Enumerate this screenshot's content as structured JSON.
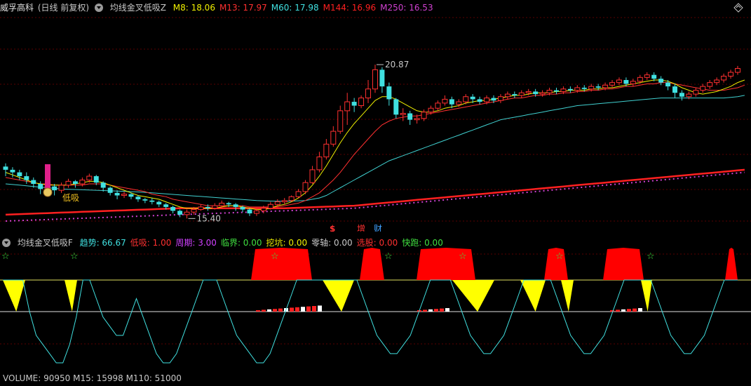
{
  "main_chart": {
    "stock_name": "威孚高科",
    "period": "(日线 前复权)",
    "indicator_name": "均线金叉低吸Z",
    "ma_items": [
      {
        "label": "M8: 18.06",
        "color": "#f0f000"
      },
      {
        "label": "M13: 17.97",
        "color": "#ff3030"
      },
      {
        "label": "M60: 17.98",
        "color": "#40e0e0"
      },
      {
        "label": "M144: 16.96",
        "color": "#ff2020"
      },
      {
        "label": "M250: 16.53",
        "color": "#d040d0"
      }
    ],
    "high_label": "20.87",
    "low_label": "15.40",
    "signal_text": "低吸",
    "marker_s": "$",
    "marker_zeng": "增",
    "marker_cai": "财",
    "candles": [
      [
        9.25,
        9.0,
        8.5,
        9.5
      ],
      [
        9.0,
        8.8,
        8.4,
        9.2
      ],
      [
        8.8,
        8.5,
        8.2,
        9.0
      ],
      [
        8.5,
        8.2,
        7.9,
        8.8
      ],
      [
        8.2,
        7.9,
        7.6,
        8.4
      ],
      [
        7.9,
        7.5,
        7.1,
        8.1
      ],
      [
        7.5,
        7.7,
        7.3,
        7.9
      ],
      [
        7.7,
        7.4,
        7.0,
        7.9
      ],
      [
        7.4,
        7.8,
        7.2,
        8.0
      ],
      [
        7.8,
        8.1,
        7.6,
        8.3
      ],
      [
        8.1,
        7.9,
        7.6,
        8.2
      ],
      [
        7.9,
        8.2,
        7.7,
        8.4
      ],
      [
        8.2,
        8.5,
        8.0,
        8.7
      ],
      [
        8.5,
        8.0,
        7.8,
        8.6
      ],
      [
        8.0,
        7.6,
        7.3,
        8.1
      ],
      [
        7.6,
        7.2,
        7.0,
        7.7
      ],
      [
        7.2,
        7.0,
        6.7,
        7.4
      ],
      [
        7.0,
        7.1,
        6.8,
        7.3
      ],
      [
        7.1,
        6.9,
        6.7,
        7.2
      ],
      [
        6.9,
        6.7,
        6.5,
        7.0
      ],
      [
        6.7,
        6.6,
        6.4,
        6.8
      ],
      [
        6.6,
        6.5,
        6.3,
        6.8
      ],
      [
        6.5,
        6.3,
        6.1,
        6.6
      ],
      [
        6.3,
        6.1,
        5.9,
        6.4
      ],
      [
        6.1,
        5.8,
        5.6,
        6.2
      ],
      [
        5.8,
        5.5,
        5.3,
        5.9
      ],
      [
        5.5,
        5.7,
        5.2,
        5.9
      ],
      [
        5.7,
        5.9,
        5.5,
        6.1
      ],
      [
        5.9,
        6.1,
        5.8,
        6.3
      ],
      [
        6.1,
        6.0,
        5.8,
        6.3
      ],
      [
        6.0,
        6.2,
        5.9,
        6.4
      ],
      [
        6.2,
        6.4,
        6.0,
        6.6
      ],
      [
        6.4,
        6.3,
        6.1,
        6.5
      ],
      [
        6.3,
        6.1,
        5.8,
        6.4
      ],
      [
        6.1,
        5.9,
        5.7,
        6.2
      ],
      [
        5.9,
        5.6,
        5.4,
        6.0
      ],
      [
        5.6,
        5.8,
        5.4,
        6.0
      ],
      [
        5.8,
        6.0,
        5.6,
        6.2
      ],
      [
        6.0,
        6.3,
        5.9,
        6.5
      ],
      [
        6.3,
        6.5,
        6.1,
        6.7
      ],
      [
        6.5,
        6.6,
        6.3,
        6.8
      ],
      [
        6.6,
        6.9,
        6.5,
        7.0
      ],
      [
        6.9,
        7.3,
        6.8,
        7.5
      ],
      [
        7.3,
        8.0,
        7.1,
        8.2
      ],
      [
        8.0,
        9.0,
        7.9,
        9.3
      ],
      [
        9.0,
        10.0,
        8.8,
        10.4
      ],
      [
        10.0,
        11.0,
        9.8,
        11.4
      ],
      [
        11.0,
        12.0,
        10.8,
        12.4
      ],
      [
        12.0,
        13.6,
        11.8,
        14.0
      ],
      [
        13.6,
        14.3,
        12.5,
        15.0
      ],
      [
        14.3,
        14.0,
        13.5,
        14.6
      ],
      [
        14.0,
        14.6,
        13.8,
        14.8
      ],
      [
        14.6,
        15.3,
        14.2,
        16.0
      ],
      [
        15.3,
        16.8,
        15.0,
        17.2
      ],
      [
        16.8,
        15.5,
        15.0,
        17.0
      ],
      [
        15.5,
        14.5,
        14.0,
        15.8
      ],
      [
        14.5,
        13.3,
        13.0,
        14.6
      ],
      [
        13.3,
        13.4,
        12.8,
        13.8
      ],
      [
        13.4,
        12.9,
        12.5,
        13.6
      ],
      [
        12.9,
        13.0,
        12.6,
        13.3
      ],
      [
        13.0,
        13.5,
        12.8,
        13.7
      ],
      [
        13.5,
        13.8,
        13.3,
        14.0
      ],
      [
        13.8,
        14.2,
        13.6,
        14.4
      ],
      [
        14.2,
        14.5,
        14.0,
        14.8
      ],
      [
        14.5,
        14.1,
        13.8,
        14.7
      ],
      [
        14.1,
        14.3,
        13.9,
        14.5
      ],
      [
        14.3,
        14.7,
        14.1,
        14.9
      ],
      [
        14.7,
        14.5,
        14.2,
        14.9
      ],
      [
        14.5,
        14.3,
        14.1,
        14.7
      ],
      [
        14.3,
        14.6,
        14.1,
        14.8
      ],
      [
        14.6,
        14.4,
        14.2,
        14.8
      ],
      [
        14.4,
        14.7,
        14.2,
        14.9
      ],
      [
        14.7,
        14.9,
        14.5,
        15.1
      ],
      [
        14.9,
        14.8,
        14.6,
        15.1
      ],
      [
        14.8,
        15.0,
        14.6,
        15.2
      ],
      [
        15.0,
        15.1,
        14.8,
        15.3
      ],
      [
        15.1,
        14.9,
        14.7,
        15.3
      ],
      [
        14.9,
        15.0,
        14.7,
        15.2
      ],
      [
        15.0,
        15.2,
        14.8,
        15.4
      ],
      [
        15.2,
        15.1,
        14.9,
        15.4
      ],
      [
        15.1,
        15.3,
        14.9,
        15.5
      ],
      [
        15.3,
        15.2,
        15.0,
        15.5
      ],
      [
        15.2,
        15.4,
        15.0,
        15.6
      ],
      [
        15.4,
        15.3,
        15.1,
        15.6
      ],
      [
        15.3,
        15.5,
        15.1,
        15.7
      ],
      [
        15.5,
        15.4,
        15.2,
        15.7
      ],
      [
        15.4,
        15.6,
        15.2,
        15.8
      ],
      [
        15.6,
        15.8,
        15.4,
        16.0
      ],
      [
        15.8,
        16.0,
        15.6,
        16.2
      ],
      [
        16.0,
        15.7,
        15.5,
        16.2
      ],
      [
        15.7,
        15.9,
        15.5,
        16.1
      ],
      [
        15.9,
        16.2,
        15.7,
        16.4
      ],
      [
        16.2,
        16.4,
        16.0,
        16.6
      ],
      [
        16.4,
        16.1,
        15.9,
        16.6
      ],
      [
        16.1,
        15.8,
        15.6,
        16.3
      ],
      [
        15.8,
        15.5,
        15.2,
        16.0
      ],
      [
        15.5,
        15.0,
        14.6,
        15.7
      ],
      [
        15.0,
        14.7,
        14.4,
        15.2
      ],
      [
        14.7,
        14.9,
        14.5,
        15.1
      ],
      [
        14.9,
        15.2,
        14.7,
        15.4
      ],
      [
        15.2,
        15.5,
        15.0,
        15.7
      ],
      [
        15.5,
        15.8,
        15.3,
        16.0
      ],
      [
        15.8,
        16.0,
        15.6,
        16.2
      ],
      [
        16.0,
        16.3,
        15.8,
        16.5
      ],
      [
        16.3,
        16.6,
        16.1,
        16.8
      ],
      [
        16.6,
        16.9,
        16.4,
        17.1
      ]
    ],
    "price_lines": {
      "m8": [
        8.8,
        8.6,
        8.4,
        8.2,
        8.0,
        7.9,
        7.8,
        7.8,
        7.8,
        7.8,
        7.9,
        8.0,
        8.1,
        8.1,
        8.0,
        7.8,
        7.6,
        7.4,
        7.2,
        7.0,
        6.9,
        6.8,
        6.7,
        6.5,
        6.3,
        6.1,
        6.0,
        6.0,
        6.0,
        6.0,
        6.0,
        6.1,
        6.2,
        6.2,
        6.1,
        6.0,
        5.9,
        5.9,
        6.0,
        6.2,
        6.3,
        6.5,
        6.8,
        7.2,
        7.8,
        8.5,
        9.3,
        10.2,
        11.1,
        11.9,
        12.6,
        13.2,
        13.8,
        14.4,
        14.7,
        14.7,
        14.5,
        14.2,
        13.9,
        13.6,
        13.5,
        13.5,
        13.6,
        13.8,
        13.9,
        14.0,
        14.2,
        14.3,
        14.4,
        14.4,
        14.5,
        14.6,
        14.7,
        14.8,
        14.8,
        14.9,
        15.0,
        15.0,
        15.0,
        15.1,
        15.1,
        15.2,
        15.2,
        15.2,
        15.3,
        15.3,
        15.4,
        15.4,
        15.5,
        15.6,
        15.7,
        15.8,
        15.9,
        16.0,
        16.0,
        15.9,
        15.7,
        15.4,
        15.2,
        15.0,
        14.9,
        15.0,
        15.1,
        15.3,
        15.5,
        15.8,
        16.0
      ],
      "m13": [
        8.4,
        8.3,
        8.2,
        8.1,
        8.0,
        7.9,
        7.9,
        7.8,
        7.8,
        7.8,
        7.8,
        7.8,
        7.9,
        7.9,
        7.9,
        7.8,
        7.7,
        7.6,
        7.5,
        7.4,
        7.3,
        7.1,
        7.0,
        6.9,
        6.7,
        6.6,
        6.5,
        6.4,
        6.3,
        6.2,
        6.2,
        6.2,
        6.2,
        6.2,
        6.2,
        6.1,
        6.1,
        6.1,
        6.1,
        6.1,
        6.2,
        6.3,
        6.4,
        6.6,
        6.9,
        7.2,
        7.7,
        8.2,
        8.8,
        9.5,
        10.2,
        10.8,
        11.4,
        12.0,
        12.5,
        12.8,
        13.0,
        13.1,
        13.2,
        13.2,
        13.3,
        13.4,
        13.5,
        13.6,
        13.7,
        13.8,
        13.9,
        14.0,
        14.1,
        14.2,
        14.3,
        14.4,
        14.5,
        14.6,
        14.6,
        14.7,
        14.8,
        14.8,
        14.9,
        14.9,
        15.0,
        15.0,
        15.1,
        15.1,
        15.2,
        15.2,
        15.3,
        15.3,
        15.4,
        15.5,
        15.5,
        15.6,
        15.7,
        15.7,
        15.8,
        15.8,
        15.7,
        15.6,
        15.5,
        15.4,
        15.3,
        15.2,
        15.2,
        15.2,
        15.3,
        15.4,
        15.6
      ],
      "m60": [
        7.9,
        7.85,
        7.8,
        7.75,
        7.7,
        7.65,
        7.6,
        7.55,
        7.5,
        7.48,
        7.46,
        7.44,
        7.42,
        7.4,
        7.38,
        7.36,
        7.34,
        7.32,
        7.3,
        7.27,
        7.24,
        7.2,
        7.16,
        7.12,
        7.08,
        7.04,
        7.0,
        6.96,
        6.92,
        6.88,
        6.84,
        6.8,
        6.76,
        6.72,
        6.68,
        6.64,
        6.6,
        6.58,
        6.56,
        6.55,
        6.55,
        6.56,
        6.58,
        6.6,
        6.7,
        6.8,
        7.0,
        7.3,
        7.6,
        7.9,
        8.2,
        8.5,
        8.8,
        9.1,
        9.4,
        9.7,
        9.9,
        10.1,
        10.3,
        10.5,
        10.7,
        10.9,
        11.1,
        11.3,
        11.5,
        11.7,
        11.9,
        12.1,
        12.3,
        12.5,
        12.7,
        12.9,
        13.0,
        13.1,
        13.2,
        13.3,
        13.4,
        13.5,
        13.6,
        13.7,
        13.8,
        13.9,
        14.0,
        14.05,
        14.1,
        14.15,
        14.2,
        14.25,
        14.3,
        14.35,
        14.4,
        14.45,
        14.5,
        14.55,
        14.6,
        14.6,
        14.6,
        14.6,
        14.6,
        14.6,
        14.6,
        14.6,
        14.6,
        14.6,
        14.65,
        14.7,
        14.8
      ],
      "m144": [
        5.5,
        5.52,
        5.54,
        5.56,
        5.58,
        5.6,
        5.62,
        5.64,
        5.66,
        5.68,
        5.7,
        5.72,
        5.74,
        5.76,
        5.78,
        5.8,
        5.82,
        5.84,
        5.86,
        5.88,
        5.9,
        5.92,
        5.94,
        5.96,
        5.98,
        6.0,
        6.0,
        6.0,
        6.0,
        6.0,
        6.0,
        6.0,
        6.0,
        6.0,
        6.0,
        6.0,
        6.0,
        6.0,
        6.0,
        6.0,
        6.0,
        6.02,
        6.04,
        6.06,
        6.08,
        6.1,
        6.12,
        6.14,
        6.16,
        6.18,
        6.2,
        6.25,
        6.3,
        6.35,
        6.4,
        6.45,
        6.5,
        6.55,
        6.6,
        6.65,
        6.7,
        6.75,
        6.8,
        6.85,
        6.9,
        6.95,
        7.0,
        7.05,
        7.1,
        7.15,
        7.2,
        7.25,
        7.3,
        7.35,
        7.4,
        7.45,
        7.5,
        7.55,
        7.6,
        7.65,
        7.7,
        7.75,
        7.8,
        7.85,
        7.9,
        7.95,
        8.0,
        8.05,
        8.1,
        8.15,
        8.2,
        8.25,
        8.3,
        8.35,
        8.4,
        8.45,
        8.5,
        8.55,
        8.6,
        8.65,
        8.7,
        8.75,
        8.8,
        8.85,
        8.9,
        8.95,
        9.0
      ],
      "m250": [
        5.0,
        5.02,
        5.04,
        5.06,
        5.08,
        5.1,
        5.12,
        5.14,
        5.16,
        5.18,
        5.2,
        5.22,
        5.24,
        5.26,
        5.28,
        5.3,
        5.32,
        5.34,
        5.36,
        5.38,
        5.4,
        5.42,
        5.44,
        5.46,
        5.48,
        5.5,
        5.52,
        5.54,
        5.56,
        5.58,
        5.6,
        5.62,
        5.64,
        5.66,
        5.68,
        5.7,
        5.72,
        5.74,
        5.76,
        5.78,
        5.8,
        5.82,
        5.84,
        5.86,
        5.88,
        5.9,
        5.92,
        5.94,
        5.96,
        5.98,
        6.0,
        6.05,
        6.1,
        6.15,
        6.2,
        6.25,
        6.3,
        6.35,
        6.4,
        6.45,
        6.5,
        6.55,
        6.6,
        6.65,
        6.7,
        6.75,
        6.8,
        6.85,
        6.9,
        6.95,
        7.0,
        7.05,
        7.1,
        7.15,
        7.2,
        7.25,
        7.3,
        7.35,
        7.4,
        7.45,
        7.5,
        7.55,
        7.6,
        7.65,
        7.7,
        7.75,
        7.8,
        7.85,
        7.9,
        7.95,
        8.0,
        8.05,
        8.1,
        8.15,
        8.2,
        8.25,
        8.3,
        8.35,
        8.4,
        8.45,
        8.5,
        8.55,
        8.6,
        8.65,
        8.7,
        8.75,
        8.8
      ]
    }
  },
  "sub_chart": {
    "indicator_name": "均线金叉低吸F",
    "items": [
      {
        "label": "趋势: 66.67",
        "color": "#40e0e0"
      },
      {
        "label": "低吸: 1.00",
        "color": "#ff3030"
      },
      {
        "label": "周期: 3.00",
        "color": "#d040ff"
      },
      {
        "label": "临界: 0.00",
        "color": "#40e040"
      },
      {
        "label": "挖坑: 0.00",
        "color": "#f0f000"
      },
      {
        "label": "零轴: 0.00",
        "color": "#c8c8c8"
      },
      {
        "label": "选股: 0.00",
        "color": "#ff3030"
      },
      {
        "label": "快跑: 0.00",
        "color": "#40e040"
      }
    ],
    "star_symbol": "☆",
    "trend_line": [
      100,
      100,
      100,
      100,
      66,
      40,
      30,
      20,
      10,
      10,
      30,
      60,
      100,
      100,
      80,
      60,
      50,
      40,
      40,
      60,
      80,
      60,
      40,
      20,
      10,
      10,
      20,
      40,
      60,
      80,
      100,
      100,
      100,
      80,
      60,
      40,
      30,
      20,
      10,
      10,
      20,
      40,
      60,
      80,
      100,
      100,
      100,
      100,
      100,
      100,
      100,
      100,
      100,
      100,
      80,
      60,
      40,
      30,
      20,
      20,
      30,
      40,
      60,
      80,
      100,
      100,
      100,
      100,
      80,
      60,
      40,
      30,
      20,
      20,
      30,
      40,
      60,
      80,
      100,
      100,
      100,
      100,
      100,
      80,
      60,
      40,
      30,
      20,
      20,
      30,
      40,
      60,
      80,
      100,
      100,
      100,
      100,
      100,
      80,
      60,
      40,
      30,
      20,
      20,
      30,
      40,
      60,
      80,
      100,
      100,
      100
    ]
  },
  "volume_bar": {
    "label": "VOLUME: 90950  M15: 15998  M110: 51000"
  },
  "colors": {
    "background": "#000000",
    "up": "#ff3030",
    "down": "#40e0e0",
    "grid": "#5a0000",
    "separator": "#b00000"
  }
}
